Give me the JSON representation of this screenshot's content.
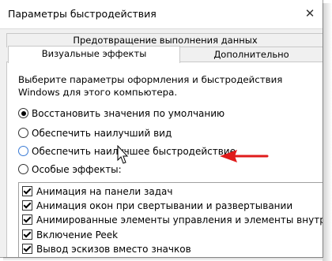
{
  "window": {
    "title": "Параметры быстродействия",
    "close_glyph": "✕"
  },
  "tabs": {
    "top_row": "Предотвращение выполнения данных",
    "visual_effects": "Визуальные эффекты",
    "advanced": "Дополнительно"
  },
  "panel": {
    "description": "Выберите параметры оформления и быстродействия Windows для этого компьютера.",
    "options": [
      {
        "label": "Восстановить значения по умолчанию",
        "selected": true
      },
      {
        "label": "Обеспечить наилучший вид",
        "selected": false
      },
      {
        "label": "Обеспечить наилучшее быстродействие",
        "selected": false
      },
      {
        "label": "Особые эффекты:",
        "selected": false
      }
    ],
    "effects": [
      {
        "label": "Анимация на панели задач",
        "checked": true
      },
      {
        "label": "Анимация окон при свертывании и развертывании",
        "checked": true
      },
      {
        "label": "Анимированные элементы управления и элементы внутри окн",
        "checked": true
      },
      {
        "label": "Включение Peek",
        "checked": true
      },
      {
        "label": "Вывод эскизов вместо значков",
        "checked": true
      }
    ]
  },
  "annotation": {
    "arrow_color": "#e01b1b",
    "icon": "red-arrow-icon"
  }
}
